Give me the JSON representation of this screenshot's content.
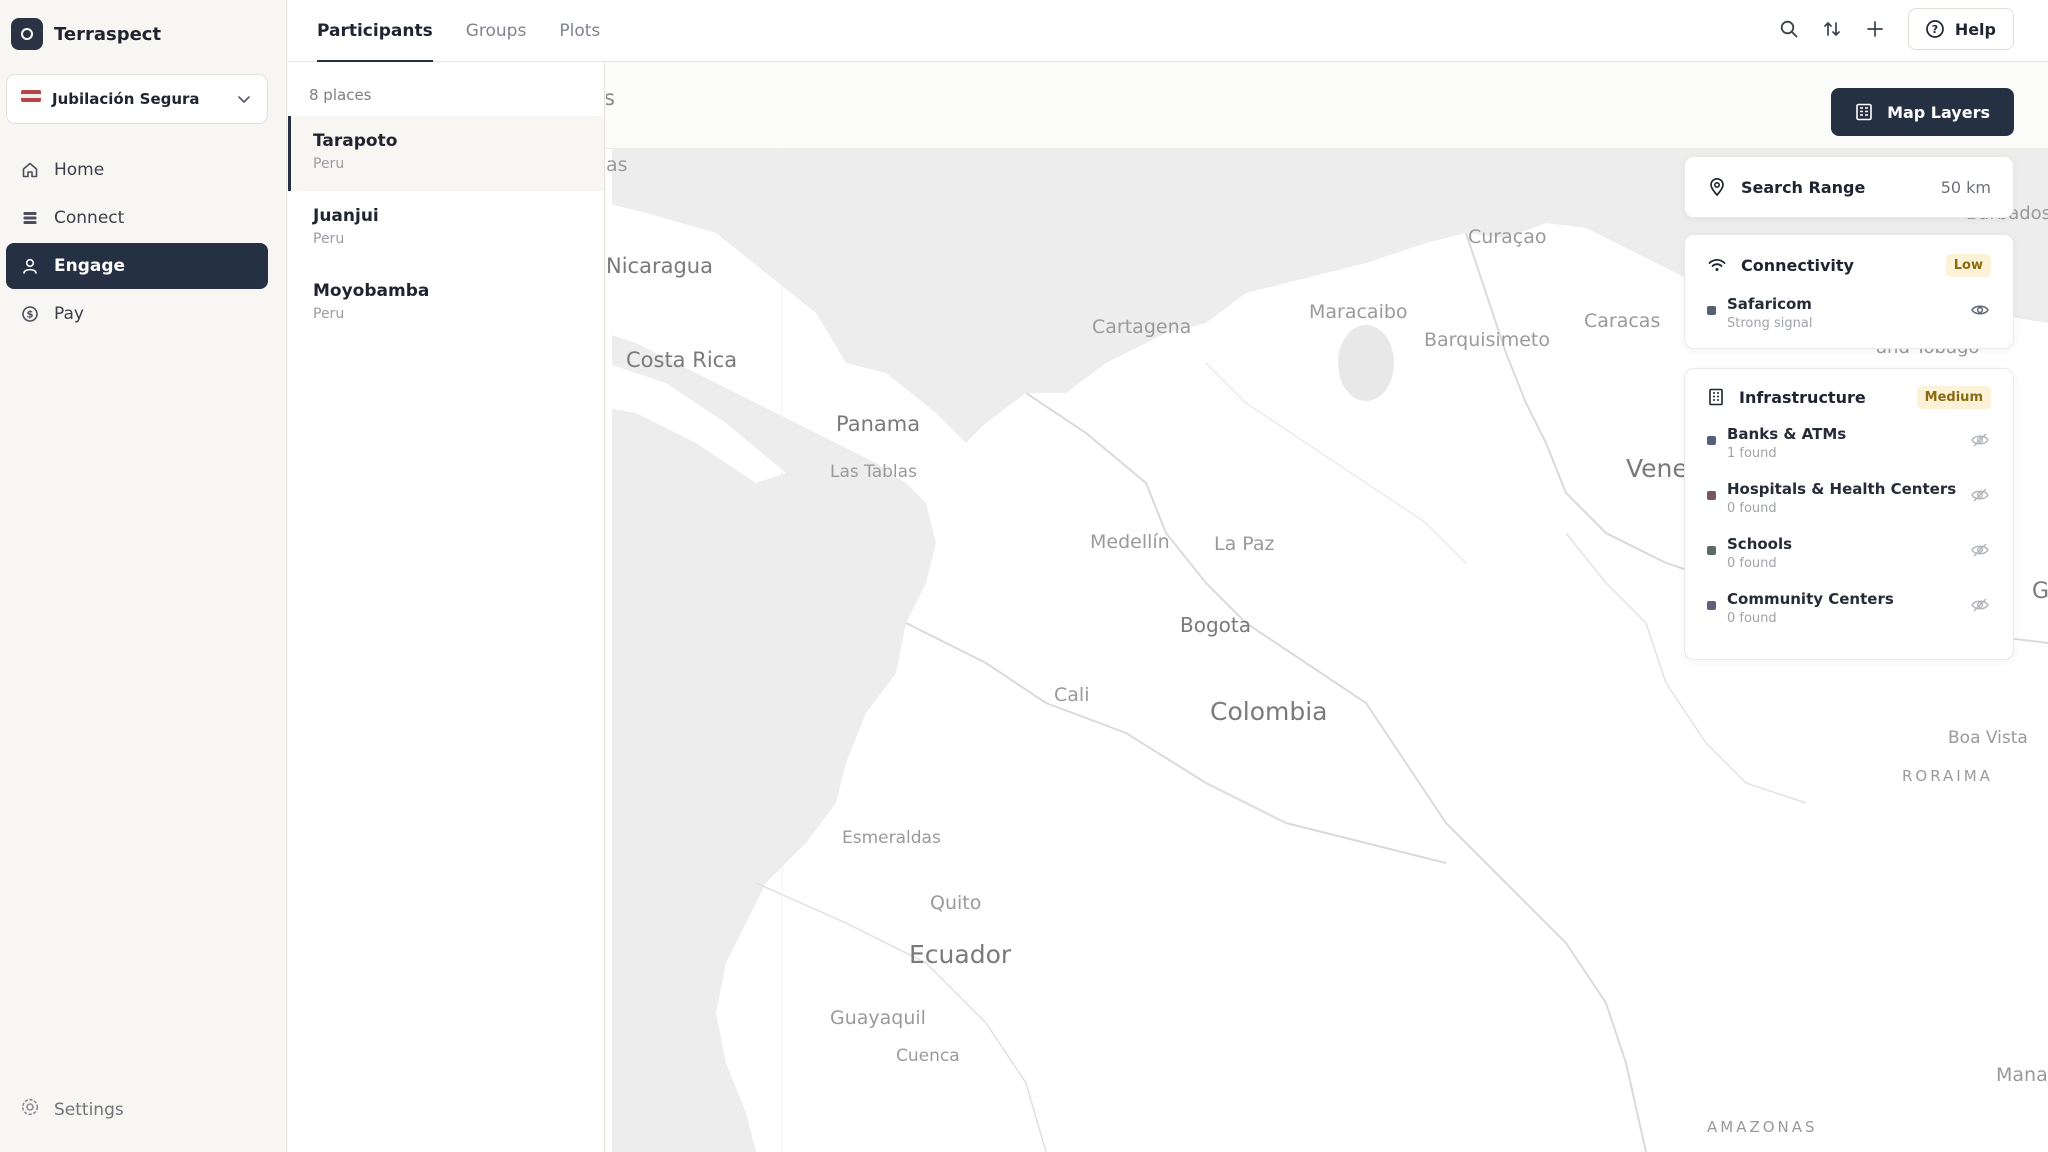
{
  "app": {
    "name": "Terraspect"
  },
  "org": {
    "name": "Jubilación Segura"
  },
  "nav": {
    "items": [
      {
        "label": "Home",
        "icon": "home-icon"
      },
      {
        "label": "Connect",
        "icon": "database-icon"
      },
      {
        "label": "Engage",
        "icon": "user-icon",
        "active": true
      },
      {
        "label": "Pay",
        "icon": "dollar-icon"
      }
    ],
    "settings_label": "Settings"
  },
  "tabs": [
    {
      "label": "Participants",
      "active": true
    },
    {
      "label": "Groups"
    },
    {
      "label": "Plots"
    }
  ],
  "toolbar": {
    "help_label": "Help"
  },
  "places": {
    "count_label": "8 places",
    "items": [
      {
        "name": "Tarapoto",
        "country": "Peru",
        "selected": true
      },
      {
        "name": "Juanjui",
        "country": "Peru"
      },
      {
        "name": "Moyobamba",
        "country": "Peru"
      }
    ]
  },
  "map": {
    "layers_button": "Map Layers",
    "labels": {
      "nicaragua": "Nicaragua",
      "costa_rica": "Costa Rica",
      "panama": "Panama",
      "las_tablas": "Las Tablas",
      "curacao": "Curaçao",
      "cartagena": "Cartagena",
      "maracaibo": "Maracaibo",
      "caracas": "Caracas",
      "barquisimeto": "Barquisimeto",
      "medellin": "Medellín",
      "la_paz": "La Paz",
      "bogota": "Bogota",
      "cali": "Cali",
      "colombia": "Colombia",
      "venezuela_partial": "Vene",
      "boa_vista": "Boa Vista",
      "roraima": "RORAIMA",
      "esmeraldas": "Esmeraldas",
      "quito": "Quito",
      "ecuador": "Ecuador",
      "guayaquil": "Guayaquil",
      "cuenca": "Cuenca",
      "amazonas": "AMAZONAS",
      "manaus_partial": "Mana",
      "trinidad_partial": "and Tobago",
      "barbados_partial": "Barbados",
      "guyana_partial": "G",
      "bahamas_partial": "as",
      "header_partial": "s"
    }
  },
  "panels": {
    "search_range": {
      "title": "Search Range",
      "value": "50 km"
    },
    "connectivity": {
      "title": "Connectivity",
      "badge": "Low",
      "items": [
        {
          "name": "Safaricom",
          "sub": "Strong signal",
          "color": "#56606f",
          "visible": true
        }
      ]
    },
    "infrastructure": {
      "title": "Infrastructure",
      "badge": "Medium",
      "items": [
        {
          "name": "Banks & ATMs",
          "sub": "1 found",
          "color": "#56607a"
        },
        {
          "name": "Hospitals & Health Centers",
          "sub": "0 found",
          "color": "#7a5656"
        },
        {
          "name": "Schools",
          "sub": "0 found",
          "color": "#5c6a66"
        },
        {
          "name": "Community Centers",
          "sub": "0 found",
          "color": "#61607a"
        }
      ]
    }
  }
}
